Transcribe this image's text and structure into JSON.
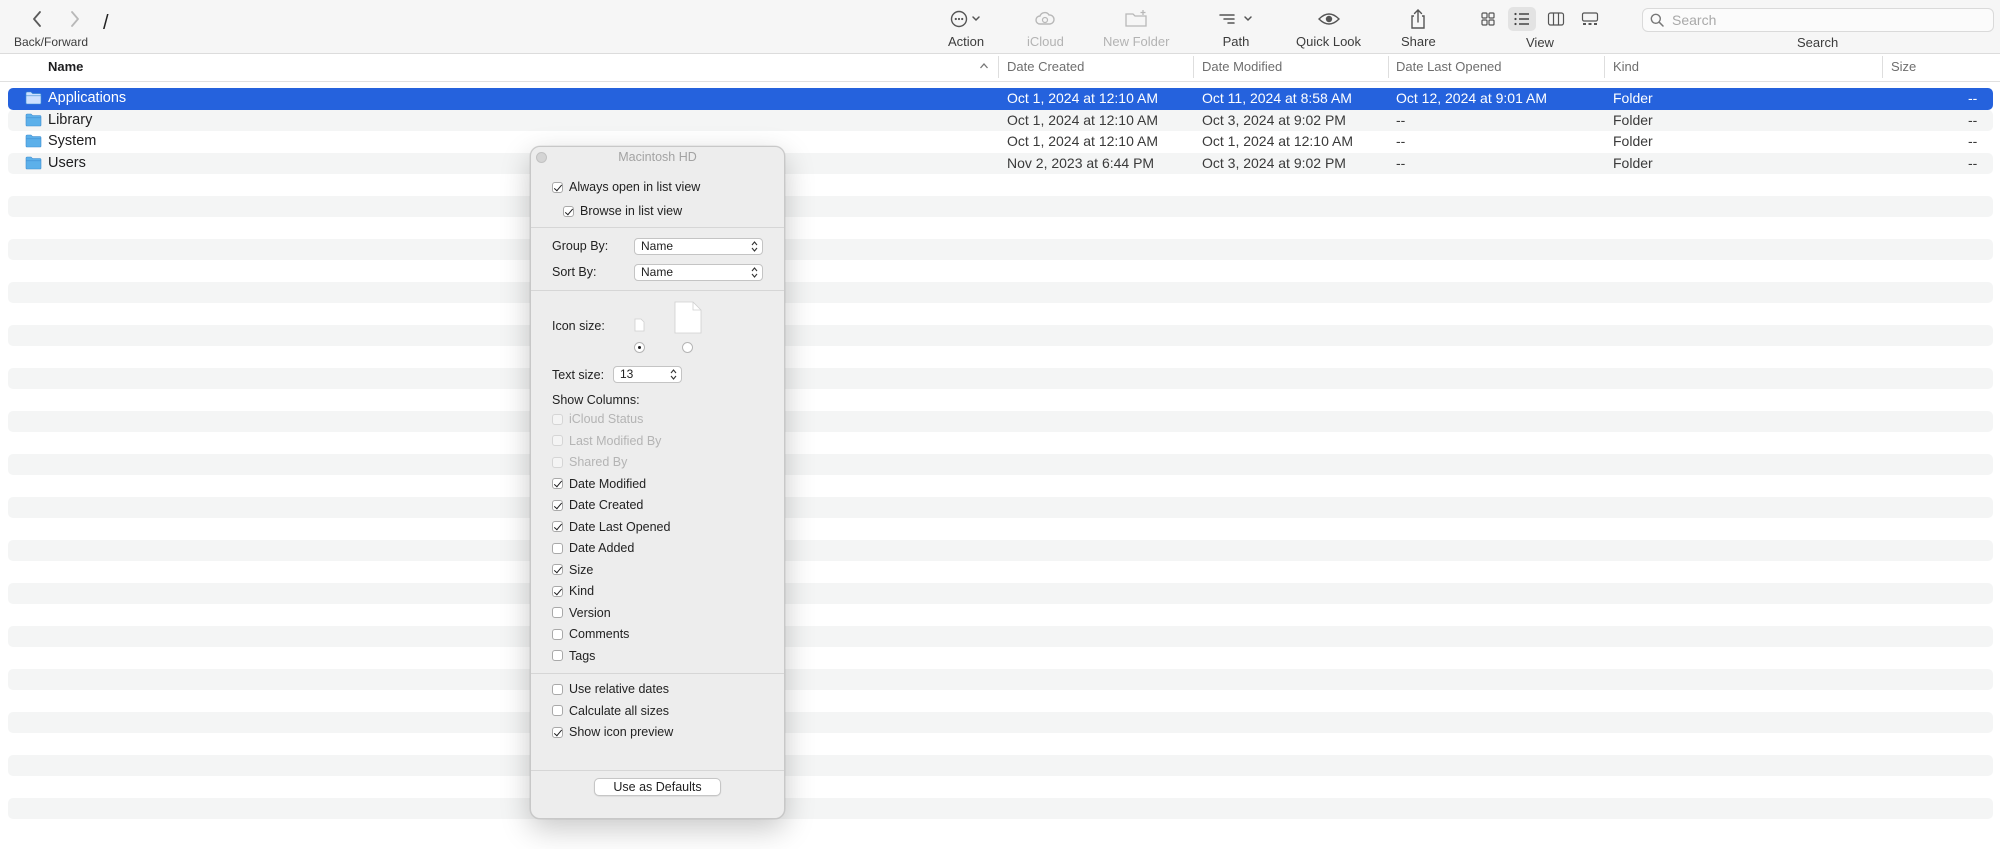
{
  "toolbar": {
    "back_forward_label": "Back/Forward",
    "path": "/",
    "action_label": "Action",
    "icloud_label": "iCloud",
    "new_folder_label": "New Folder",
    "path_label": "Path",
    "quick_look_label": "Quick Look",
    "share_label": "Share",
    "view_label": "View",
    "search_label": "Search",
    "search_placeholder": "Search",
    "active_view": "list"
  },
  "columns": {
    "name": "Name",
    "date_created": "Date Created",
    "date_modified": "Date Modified",
    "date_last_opened": "Date Last Opened",
    "kind": "Kind",
    "size": "Size"
  },
  "files": [
    {
      "name": "Applications",
      "created": "Oct 1, 2024 at 12:10 AM",
      "modified": "Oct 11, 2024 at 8:58 AM",
      "last_opened": "Oct 12, 2024 at 9:01 AM",
      "kind": "Folder",
      "size": "--",
      "selected": true
    },
    {
      "name": "Library",
      "created": "Oct 1, 2024 at 12:10 AM",
      "modified": "Oct 3, 2024 at 9:02 PM",
      "last_opened": "--",
      "kind": "Folder",
      "size": "--"
    },
    {
      "name": "System",
      "created": "Oct 1, 2024 at 12:10 AM",
      "modified": "Oct 1, 2024 at 12:10 AM",
      "last_opened": "--",
      "kind": "Folder",
      "size": "--"
    },
    {
      "name": "Users",
      "created": "Nov 2, 2023 at 6:44 PM",
      "modified": "Oct 3, 2024 at 9:02 PM",
      "last_opened": "--",
      "kind": "Folder",
      "size": "--"
    }
  ],
  "panel": {
    "title": "Macintosh HD",
    "always_open_list": {
      "label": "Always open in list view",
      "checked": true
    },
    "browse_list": {
      "label": "Browse in list view",
      "checked": true
    },
    "group_by_label": "Group By:",
    "group_by_value": "Name",
    "sort_by_label": "Sort By:",
    "sort_by_value": "Name",
    "icon_size_label": "Icon size:",
    "icon_size_selected": "small",
    "text_size_label": "Text size:",
    "text_size_value": "13",
    "show_columns_label": "Show Columns:",
    "columns": [
      {
        "label": "iCloud Status",
        "checked": false,
        "disabled": true
      },
      {
        "label": "Last Modified By",
        "checked": false,
        "disabled": true
      },
      {
        "label": "Shared By",
        "checked": false,
        "disabled": true
      },
      {
        "label": "Date Modified",
        "checked": true
      },
      {
        "label": "Date Created",
        "checked": true
      },
      {
        "label": "Date Last Opened",
        "checked": true
      },
      {
        "label": "Date Added",
        "checked": false
      },
      {
        "label": "Size",
        "checked": true
      },
      {
        "label": "Kind",
        "checked": true
      },
      {
        "label": "Version",
        "checked": false
      },
      {
        "label": "Comments",
        "checked": false
      },
      {
        "label": "Tags",
        "checked": false
      }
    ],
    "options": [
      {
        "label": "Use relative dates",
        "checked": false
      },
      {
        "label": "Calculate all sizes",
        "checked": false
      },
      {
        "label": "Show icon preview",
        "checked": true
      }
    ],
    "defaults_button": "Use as Defaults"
  }
}
